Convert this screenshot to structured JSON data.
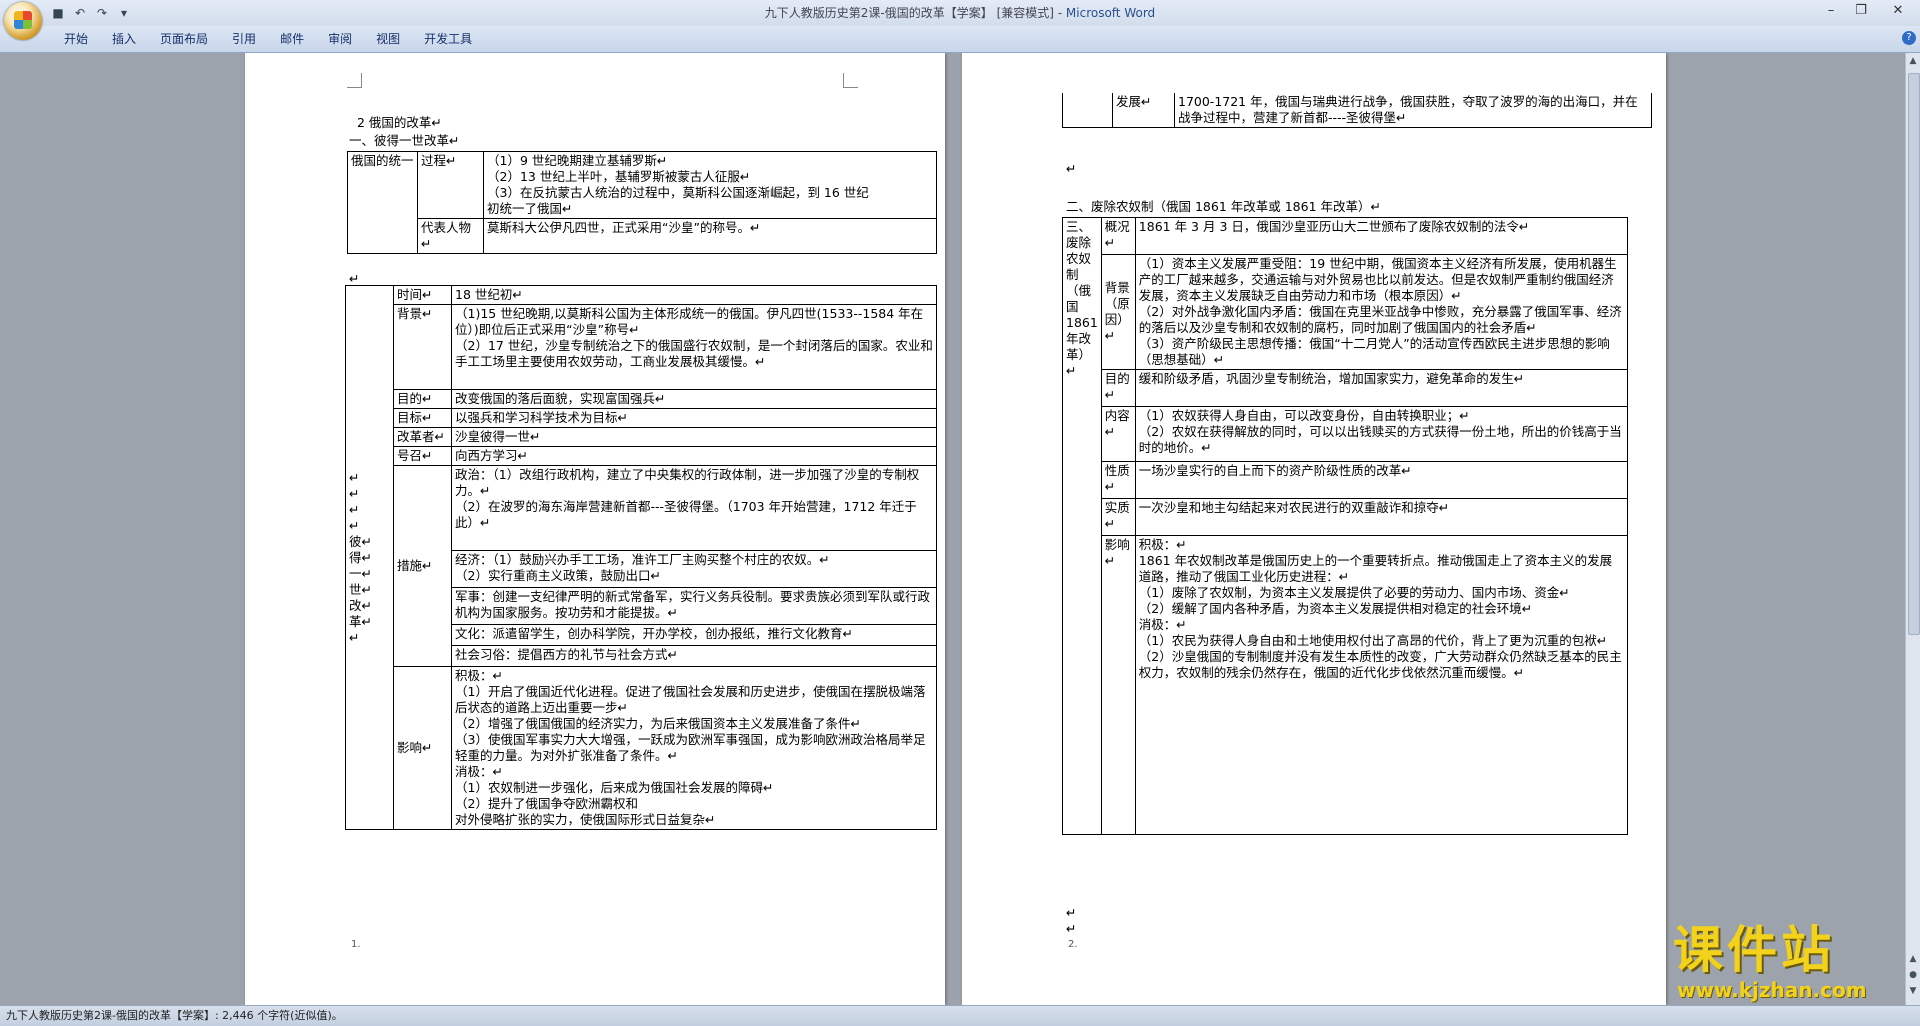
{
  "window": {
    "title": "九下人教版历史第2课-俄国的改革【学案】 [兼容模式] - ",
    "app": "Microsoft Word"
  },
  "qat": {
    "icons": [
      "save-icon",
      "undo-icon",
      "redo-icon",
      "customize-icon"
    ]
  },
  "ribbon": {
    "tabs": [
      "开始",
      "插入",
      "页面布局",
      "引用",
      "邮件",
      "审阅",
      "视图",
      "开发工具"
    ]
  },
  "page1": {
    "heading": "2 俄国的改革↵",
    "section1": "一、彼得一世改革↵",
    "table1": {
      "r0c0": "俄国的统一",
      "r0c1": "过程↵",
      "r0c2": [
        "（1）9 世纪晚期建立基辅罗斯↵",
        "（2）13 世纪上半叶，基辅罗斯被蒙古人征服↵",
        "（3）在反抗蒙古人统治的过程中，莫斯科公国逐渐崛起，到 16 世纪",
        "初统一了俄国↵"
      ],
      "r1c1": "代表人物↵",
      "r1c2": "莫斯科大公伊凡四世，正式采用“沙皇”的称号。↵"
    },
    "table2": {
      "label": [
        "↵",
        "↵",
        "↵",
        "↵",
        "彼↵",
        "得↵",
        "一↵",
        "世↵",
        "改↵",
        "革↵",
        "↵"
      ],
      "rows": [
        {
          "k": "时间↵",
          "v": [
            "18 世纪初↵"
          ]
        },
        {
          "k": "背景↵",
          "v": [
            "（1)15 世纪晚期,以莫斯科公国为主体形成统一的俄国。伊凡四世(1533--1584 年在位）)即位后正式采用“沙皇”称号↵",
            "（2）17 世纪，沙皇专制统治之下的俄国盛行农奴制，是一个封闭落后的国家。农业和手工工场里主要使用农奴劳动，工商业发展极其缓慢。↵"
          ]
        },
        {
          "k": "目的↵",
          "v": [
            "改变俄国的落后面貌，实现富国强兵↵"
          ]
        },
        {
          "k": "目标↵",
          "v": [
            "以强兵和学习科学技术为目标↵"
          ]
        },
        {
          "k": "改革者↵",
          "v": [
            "沙皇彼得一世↵"
          ]
        },
        {
          "k": "号召↵",
          "v": [
            "向西方学习↵"
          ]
        }
      ],
      "measures_label": "措施↵",
      "measures": [
        [
          "政治：（1）改组行政机构，建立了中央集权的行政体制，进一步加强了沙皇的专制权力。↵",
          "（2）在波罗的海东海岸营建新首都---圣彼得堡。（1703 年开始营建，1712 年迁于此）↵"
        ],
        [
          "经济：（1）鼓励兴办手工工场，准许工厂主购买整个村庄的农奴。↵",
          "（2）实行重商主义政策，鼓励出口↵"
        ],
        [
          "军事：创建一支纪律严明的新式常备军，实行义务兵役制。要求贵族必须到军队或行政机构为国家服务。按功劳和才能提拔。↵"
        ],
        [
          "文化：派遣留学生，创办科学院，开办学校，创办报纸，推行文化教育↵"
        ],
        [
          "社会习俗：提倡西方的礼节与社会方式↵"
        ]
      ],
      "impact_label": "影响↵",
      "impact": [
        "积极：↵",
        "（1）开启了俄国近代化进程。促进了俄国社会发展和历史进步，使俄国在摆脱极端落后状态的道路上迈出重要一步↵",
        "（2）增强了俄国俄国的经济实力，为后来俄国资本主义发展准备了条件↵",
        "（3）使俄国军事实力大大增强，一跃成为欧洲军事强国，成为影响欧洲政治格局举足轻重的力量。为对外扩张准备了条件。↵",
        "消极：↵",
        "（1）农奴制进一步强化，后来成为俄国社会发展的障碍↵",
        "（2）提升了俄国争夺欧洲霸权和",
        "对外侵略扩张的实力，使俄国际形式日益复杂↵"
      ]
    },
    "page_no": "1.",
    "after_table1": "↵"
  },
  "page2": {
    "top_row": {
      "k": "发展↵",
      "v": "1700-1721 年，俄国与瑞典进行战争，俄国获胜，夺取了波罗的海的出海口，并在战争过程中，营建了新首都----圣彼得堡↵"
    },
    "blank": "↵",
    "section2": "二、废除农奴制（俄国 1861 年改革或 1861 年改革）↵",
    "table3": {
      "label": "三、废除农奴制（俄国1861年改革）↵",
      "rows": [
        {
          "k": "概况↵",
          "v": [
            "1861 年 3 月 3 日，俄国沙皇亚历山大二世颁布了废除农奴制的法令↵"
          ]
        },
        {
          "k": "背景（原因）↵",
          "v": [
            "（1）资本主义发展严重受阻：19 世纪中期，俄国资本主义经济有所发展，使用机器生产的工厂越来越多，交通运输与对外贸易也比以前发达。但是农奴制严重制约俄国经济发展，资本主义发展缺乏自由劳动力和市场（根本原因）↵",
            "（2）对外战争激化国内矛盾：俄国在克里米亚战争中惨败，充分暴露了俄国军事、经济的落后以及沙皇专制和农奴制的腐朽，同时加剧了俄国国内的社会矛盾↵",
            "（3）资产阶级民主思想传播：俄国“十二月党人”的活动宣传西欧民主进步思想的影响（思想基础）↵"
          ]
        },
        {
          "k": "目的↵",
          "v": [
            "缓和阶级矛盾，巩固沙皇专制统治，增加国家实力，避免革命的发生↵"
          ]
        },
        {
          "k": "内容↵",
          "v": [
            "（1）农奴获得人身自由，可以改变身份，自由转换职业；↵",
            "（2）农奴在获得解放的同时，可以以出钱赎买的方式获得一份土地，所出的价钱高于当时的地价。↵"
          ]
        },
        {
          "k": "性质↵",
          "v": [
            "一场沙皇实行的自上而下的资产阶级性质的改革↵"
          ]
        },
        {
          "k": "实质↵",
          "v": [
            "一次沙皇和地主勾结起来对农民进行的双重敲诈和掠夺↵"
          ]
        },
        {
          "k": "影响↵",
          "v": [
            "积极：↵",
            "1861 年农奴制改革是俄国历史上的一个重要转折点。推动俄国走上了资本主义的发展道路，推动了俄国工业化历史进程：↵",
            "（1）废除了农奴制，为资本主义发展提供了必要的劳动力、国内市场、资金↵",
            "（2）缓解了国内各种矛盾，为资本主义发展提供相对稳定的社会环境↵",
            "消极：↵",
            "（1）农民为获得人身自由和土地使用权付出了高昂的代价，背上了更为沉重的包袱↵",
            "（2）沙皇俄国的专制制度并没有发生本质性的改变，广大劳动群众仍然缺乏基本的民主权力，农奴制的残余仍然存在，俄国的近代化步伐依然沉重而缓慢。↵"
          ]
        }
      ]
    },
    "page_no": "2.",
    "trail": [
      "↵",
      "↵"
    ]
  },
  "status": {
    "text": "九下人教版历史第2课-俄国的改革【学案】: 2,446 个字符(近似值)。"
  },
  "watermark": {
    "big": "课件站",
    "url": "www.kjzhan.com"
  }
}
